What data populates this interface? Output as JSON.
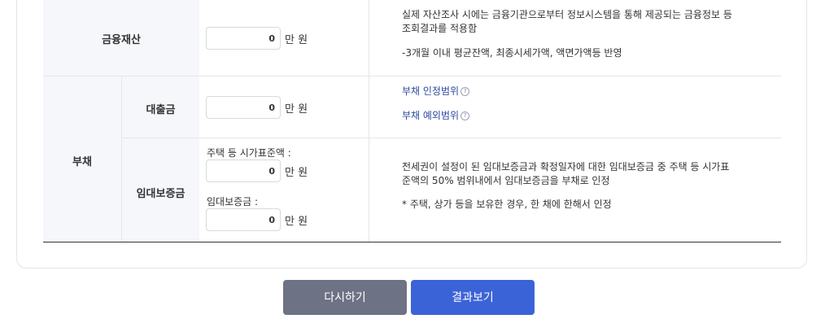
{
  "financial_assets": {
    "label": "금융재산",
    "value": "0",
    "unit": "만 원",
    "desc_line1": "실제 자산조사 시에는 금융기관으로부터 정보시스템을 통해 제공되는 금융정보 등",
    "desc_line2": "조회결과를 적용함",
    "desc_line3": "-3개월 이내 평균잔액, 최종시세가액, 액면가액등 반영"
  },
  "debt": {
    "label": "부채",
    "loan": {
      "label": "대출금",
      "value": "0",
      "unit": "만 원",
      "link_recognized": "부채 인정범위",
      "link_excluded": "부채 예외범위",
      "info_glyph": "?"
    },
    "lease_deposit": {
      "label": "임대보증금",
      "housing_label": "주택 등 시가표준액 :",
      "housing_value": "0",
      "deposit_label": "임대보증금 :",
      "deposit_value": "0",
      "unit": "만 원",
      "desc_line1": "전세권이 설정이 된 임대보증금과 확정일자에 대한 임대보증금 중 주택 등 시가표",
      "desc_line2": "준액의 50% 범위내에서 임대보증금을 부채로 인정",
      "desc_line3": "* 주택, 상가 등을 보유한 경우, 한 채에 한해서 인정"
    }
  },
  "buttons": {
    "reset": "다시하기",
    "result": "결과보기"
  },
  "colors": {
    "reset_bg": "#6e7285",
    "result_bg": "#3b63d8",
    "label_bg": "#f6f7fb",
    "link": "#2b4a9f"
  }
}
